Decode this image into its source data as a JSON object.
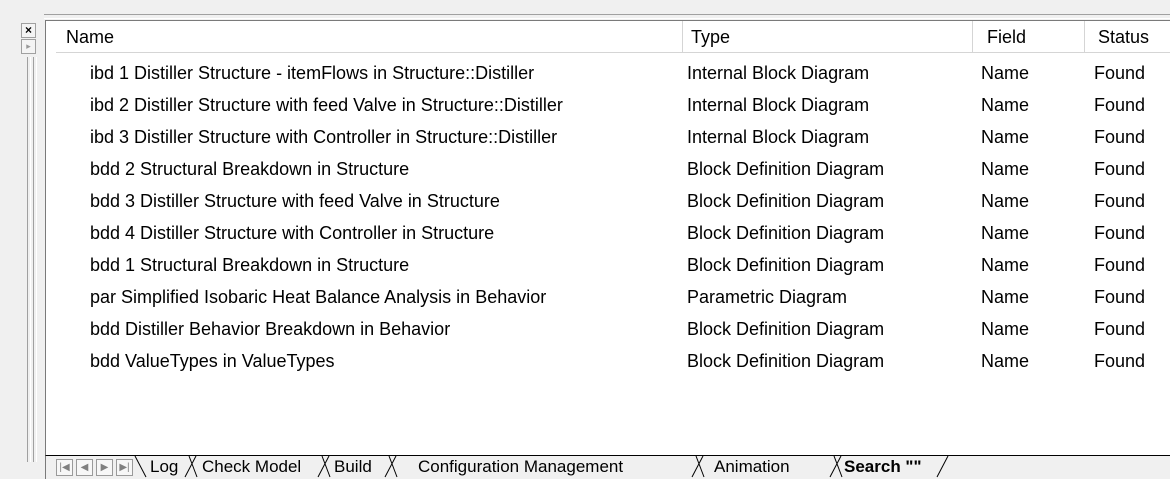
{
  "gripper": {
    "close_glyph": "×",
    "dock_glyph": "▸"
  },
  "columns": {
    "name": "Name",
    "type": "Type",
    "field": "Field",
    "status": "Status"
  },
  "rows": [
    {
      "name": "ibd 1 Distiller Structure - itemFlows in Structure::Distiller",
      "type": "Internal Block Diagram",
      "field": "Name",
      "status": "Found"
    },
    {
      "name": "ibd 2 Distiller Structure with feed Valve in Structure::Distiller",
      "type": "Internal Block Diagram",
      "field": "Name",
      "status": "Found"
    },
    {
      "name": "ibd 3 Distiller Structure with Controller in Structure::Distiller",
      "type": "Internal Block Diagram",
      "field": "Name",
      "status": "Found"
    },
    {
      "name": "bdd 2 Structural Breakdown in Structure",
      "type": "Block Definition Diagram",
      "field": "Name",
      "status": "Found"
    },
    {
      "name": "bdd 3 Distiller Structure with feed Valve in Structure",
      "type": "Block Definition Diagram",
      "field": "Name",
      "status": "Found"
    },
    {
      "name": "bdd 4 Distiller Structure with Controller in Structure",
      "type": "Block Definition Diagram",
      "field": "Name",
      "status": "Found"
    },
    {
      "name": "bdd 1 Structural Breakdown in Structure",
      "type": "Block Definition Diagram",
      "field": "Name",
      "status": "Found"
    },
    {
      "name": "par Simplified Isobaric Heat Balance Analysis in Behavior",
      "type": "Parametric Diagram",
      "field": "Name",
      "status": "Found"
    },
    {
      "name": "bdd Distiller Behavior Breakdown in Behavior",
      "type": "Block Definition Diagram",
      "field": "Name",
      "status": "Found"
    },
    {
      "name": "bdd ValueTypes in ValueTypes",
      "type": "Block Definition Diagram",
      "field": "Name",
      "status": "Found"
    }
  ],
  "tabs": {
    "nav_first": "|◀",
    "nav_prev": "◀",
    "nav_next": "▶",
    "nav_last": "▶|",
    "log": "Log",
    "check_model": "Check Model",
    "build": "Build",
    "config_mgmt": "Configuration Management",
    "animation": "Animation",
    "search": "Search \"\""
  }
}
